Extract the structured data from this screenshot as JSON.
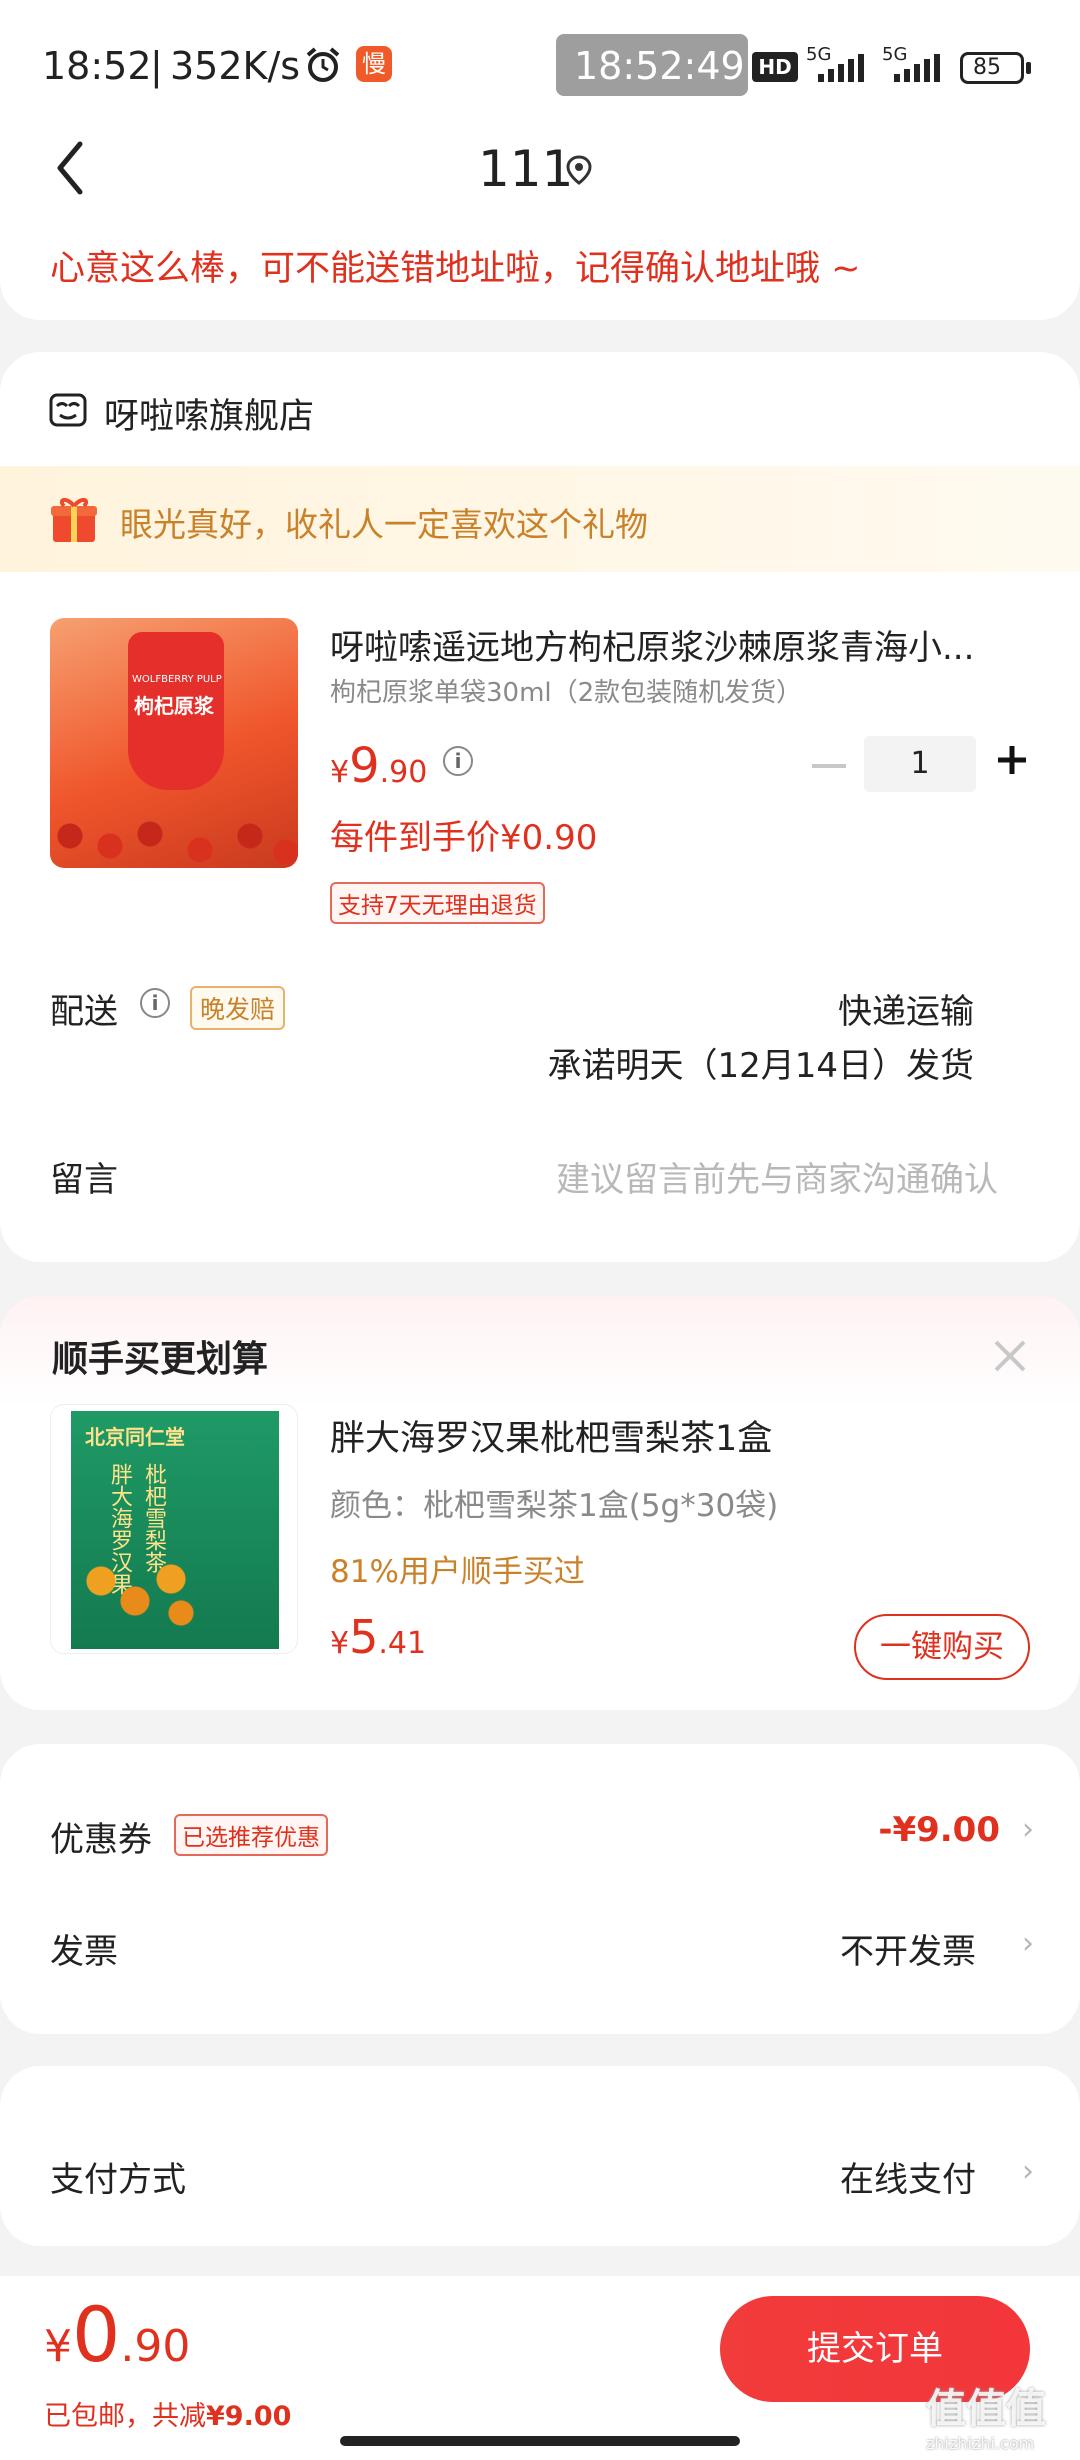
{
  "status_bar": {
    "time": "18:52",
    "speed": "352K/s",
    "app_badge": "慢",
    "clock": "18:52:49",
    "hd_badge": "HD",
    "network_1": "5G",
    "network_2": "5G",
    "battery": "85"
  },
  "header": {
    "title": "111",
    "address_tip": "心意这么棒，可不能送错地址啦，记得确认地址哦 ~"
  },
  "store": {
    "name": "呀啦嗦旗舰店",
    "gift_tip": "眼光真好，收礼人一定喜欢这个礼物",
    "product": {
      "image_label": "枸杞原浆",
      "image_sub": "WOLFBERRY PULP",
      "title": "呀啦嗦遥远地方枸杞原浆沙棘原浆青海小...",
      "spec": "枸杞原浆单袋30ml（2款包装随机发货）",
      "price_symbol": "¥",
      "price_int": "9",
      "price_dec": ".90",
      "quantity": "1",
      "unit_price": "每件到手价¥0.90",
      "return_tag": "支持7天无理由退货"
    },
    "delivery": {
      "label": "配送",
      "late_tag": "晚发赔",
      "method": "快递运输",
      "promise": "承诺明天（12月14日）发货"
    },
    "message": {
      "label": "留言",
      "placeholder": "建议留言前先与商家沟通确认"
    }
  },
  "upsell": {
    "title": "顺手买更划算",
    "product": {
      "image_brand": "北京同仁堂",
      "image_label_1": "枇杷雪梨茶",
      "image_label_2": "胖大海罗汉果",
      "title": "胖大海罗汉果枇杷雪梨茶1盒",
      "spec": "颜色：枇杷雪梨茶1盒(5g*30袋)",
      "social": "81%用户顺手买过",
      "price_symbol": "¥",
      "price_int": "5",
      "price_dec": ".41",
      "buy_button": "一键购买"
    }
  },
  "discounts": {
    "coupon_label": "优惠券",
    "coupon_tag": "已选推荐优惠",
    "coupon_value": "-¥9.00",
    "invoice_label": "发票",
    "invoice_value": "不开发票"
  },
  "payment": {
    "label": "支付方式",
    "value": "在线支付"
  },
  "footer": {
    "price_symbol": "¥",
    "price_int": "0",
    "price_dec": ".90",
    "shipping_note": "已包邮，共减",
    "total_discount": "¥9.00",
    "submit_button": "提交订单"
  },
  "watermark": {
    "text": "值值值",
    "url": "zhizhizhi.com"
  },
  "colors": {
    "accent_red": "#e0301e",
    "button_red": "#f2363a",
    "gold": "#c9822a",
    "gift_banner": "#fff7e6"
  }
}
